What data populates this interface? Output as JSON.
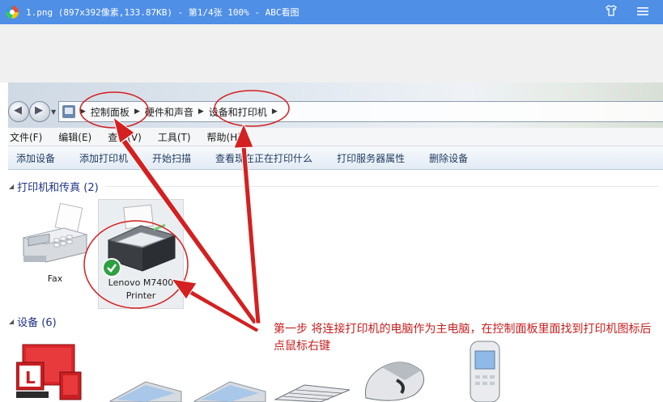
{
  "viewer": {
    "title": "1.png (897x392像素,133.87KB) - 第1/4张 100% - ABC看图"
  },
  "address_bar": {
    "crumbs": [
      "控制面板",
      "硬件和声音",
      "设备和打印机"
    ]
  },
  "menu": {
    "items": [
      "文件(F)",
      "编辑(E)",
      "查看(V)",
      "工具(T)",
      "帮助(H)"
    ]
  },
  "toolbar": {
    "items": [
      "添加设备",
      "添加打印机",
      "开始扫描",
      "查看现在正在打印什么",
      "打印服务器属性",
      "删除设备"
    ]
  },
  "groups": {
    "printers_title": "打印机和传真 (2)",
    "devices_title": "设备 (6)"
  },
  "printers": {
    "fax_label": "Fax",
    "lenovo_label_line1": "Lenovo M7400",
    "lenovo_label_line2": "Printer"
  },
  "annotation": {
    "text": "第一步 将连接打印机的电脑作为主电脑，在控制面板里面找到打印机图标后点鼠标右键",
    "color": "#d42020"
  },
  "colors": {
    "viewer_bar": "#4f8fe6",
    "group_title": "#1e3287",
    "annotation": "#c81e1e"
  }
}
